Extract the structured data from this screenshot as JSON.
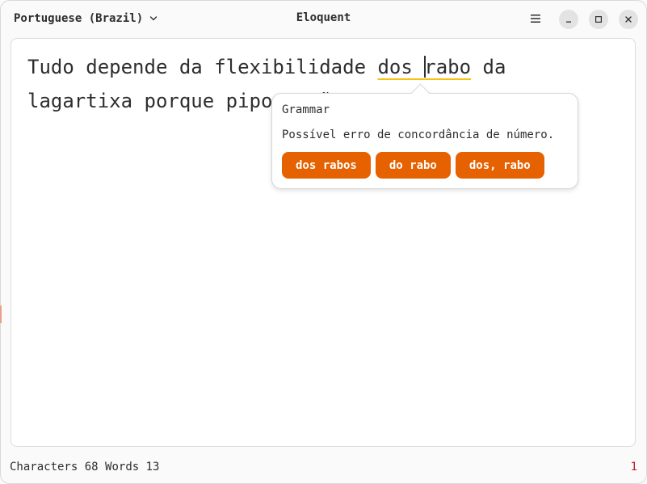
{
  "header": {
    "language": "Portuguese (Brazil)",
    "title": "Eloquent",
    "icons": [
      "chevron-down-icon",
      "hamburger-menu-icon",
      "minimize-icon",
      "maximize-icon",
      "close-icon"
    ]
  },
  "editor": {
    "line1_before": "Tudo depende da flexibilidade ",
    "error_part1": "dos ",
    "error_part2": "rabo",
    "line1_after": " da",
    "line2": "lagartixa porque pipoca não te"
  },
  "popover": {
    "title": "Grammar",
    "message": "Possível erro de concordância de número.",
    "suggestions": [
      "dos rabos",
      "do rabo",
      "dos, rabo"
    ]
  },
  "status": {
    "characters_label": "Characters",
    "characters_value": "68",
    "words_label": "Words",
    "words_value": "13",
    "error_count": "1"
  },
  "colors": {
    "accent": "#e66100",
    "error_underline": "#f5c211",
    "error_count": "#c01c28"
  }
}
